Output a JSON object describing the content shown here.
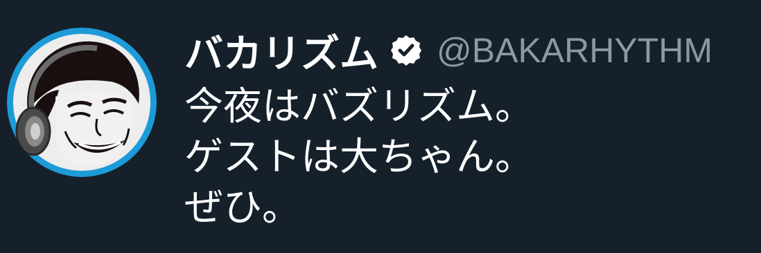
{
  "tweet": {
    "author": {
      "display_name": "バカリズム",
      "handle": "@BAKARHYTHM",
      "verified_icon": "verified-badge-icon",
      "avatar_icon": "avatar-illustration"
    },
    "lines": [
      "今夜はバズリズム。",
      "ゲストは大ちゃん。",
      "ぜひ。"
    ]
  },
  "colors": {
    "background": "#15202b",
    "text": "#ffffff",
    "handle": "#8b98a5",
    "avatar_ring": "#1d9bd8"
  }
}
